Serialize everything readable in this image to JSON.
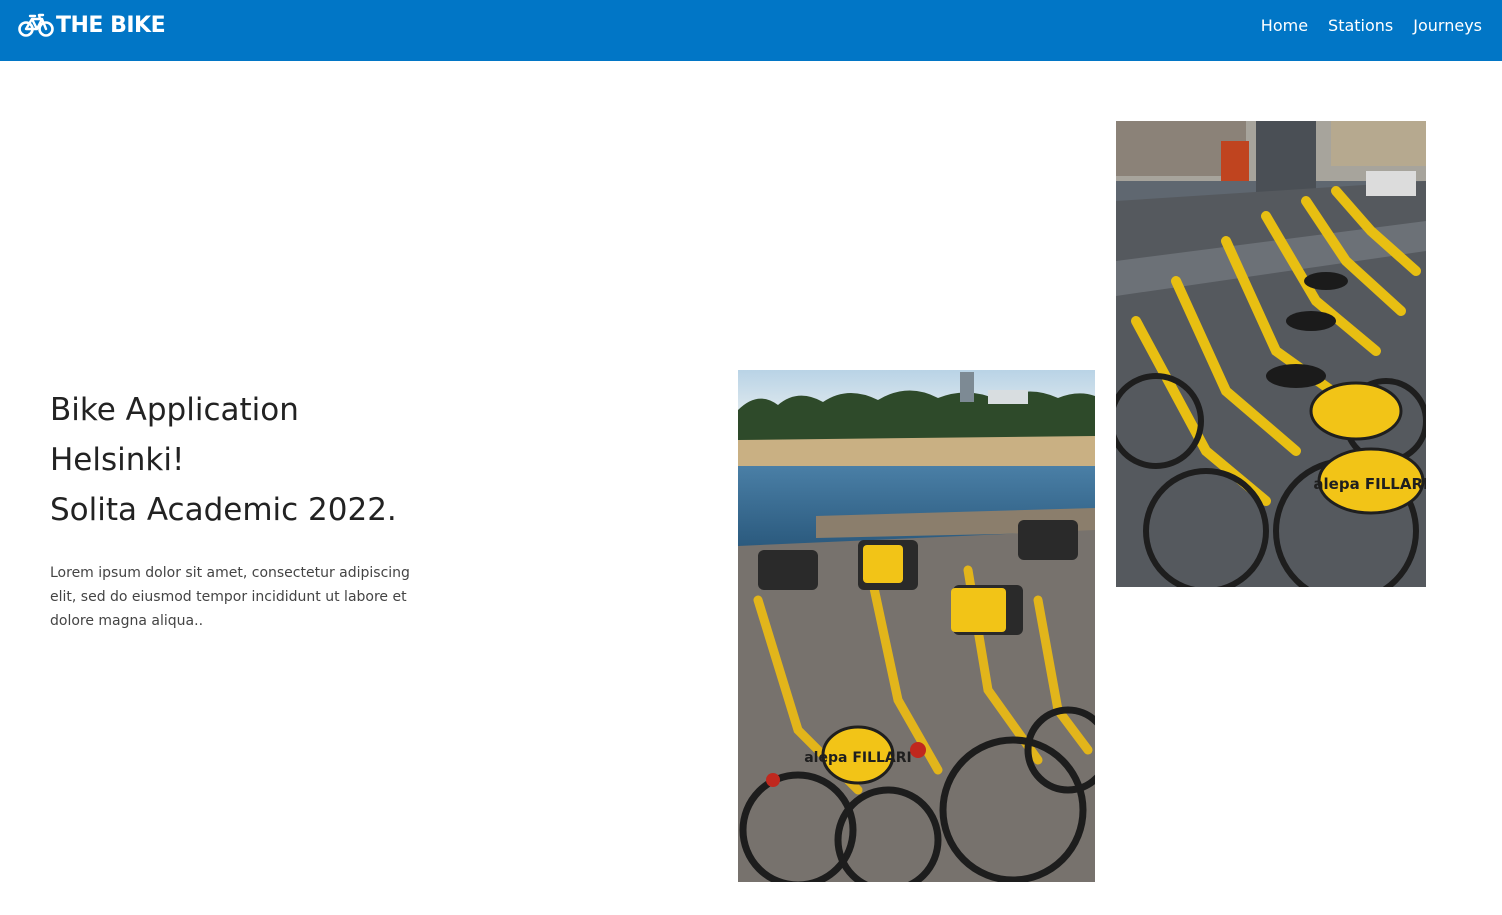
{
  "navbar": {
    "brand": "THE BIKE",
    "brand_icon": "bicycle-icon",
    "background": "#0176c6",
    "links": [
      {
        "label": "Home"
      },
      {
        "label": "Stations"
      },
      {
        "label": "Journeys"
      }
    ]
  },
  "hero": {
    "title_lines": [
      "Bike Application",
      "Helsinki!",
      "Solita Academic 2022."
    ],
    "description": "Lorem ipsum dolor sit amet, consectetur adipiscing elit, sed do eiusmod tempor incididunt ut labore et dolore magna aliqua.."
  },
  "images": [
    {
      "label": "alepa FILLARI",
      "accent": "#f2c417"
    },
    {
      "label": "alepa FILLARI",
      "accent": "#f2c417"
    }
  ]
}
